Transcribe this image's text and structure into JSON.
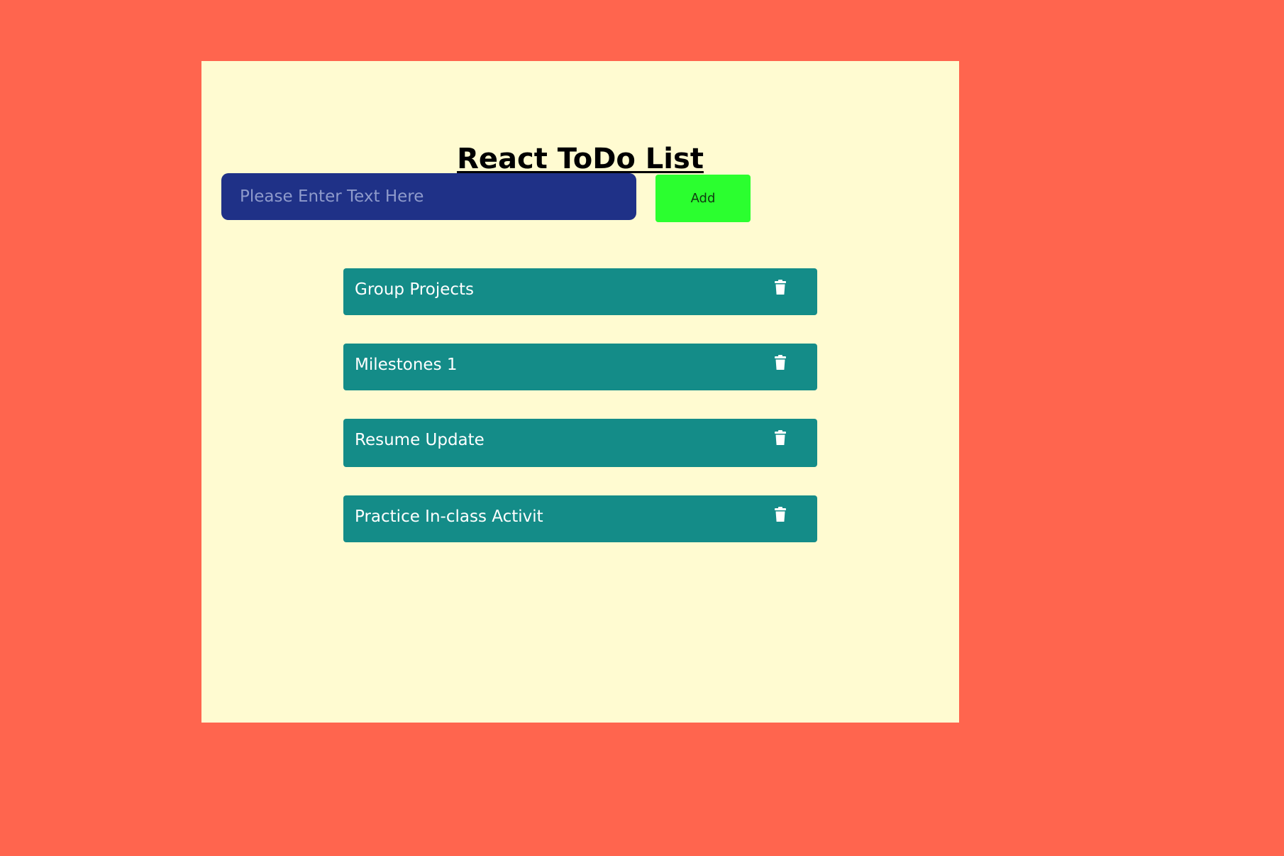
{
  "app": {
    "title": "React ToDo List"
  },
  "form": {
    "input_placeholder": "Please Enter Text Here",
    "input_value": "",
    "add_label": "Add"
  },
  "todos": [
    {
      "text": "Group Projects",
      "delete_icon": "trash-icon"
    },
    {
      "text": "Milestones 1",
      "delete_icon": "trash-icon"
    },
    {
      "text": "Resume Update",
      "delete_icon": "trash-icon"
    },
    {
      "text": "Practice In-class Activit",
      "delete_icon": "trash-icon"
    }
  ],
  "colors": {
    "page_background": "#ff654e",
    "panel_background": "#fffbd1",
    "input_background": "#1f3187",
    "add_button": "#2bff2f",
    "todo_item": "#148c88",
    "todo_text": "#ffffff"
  }
}
